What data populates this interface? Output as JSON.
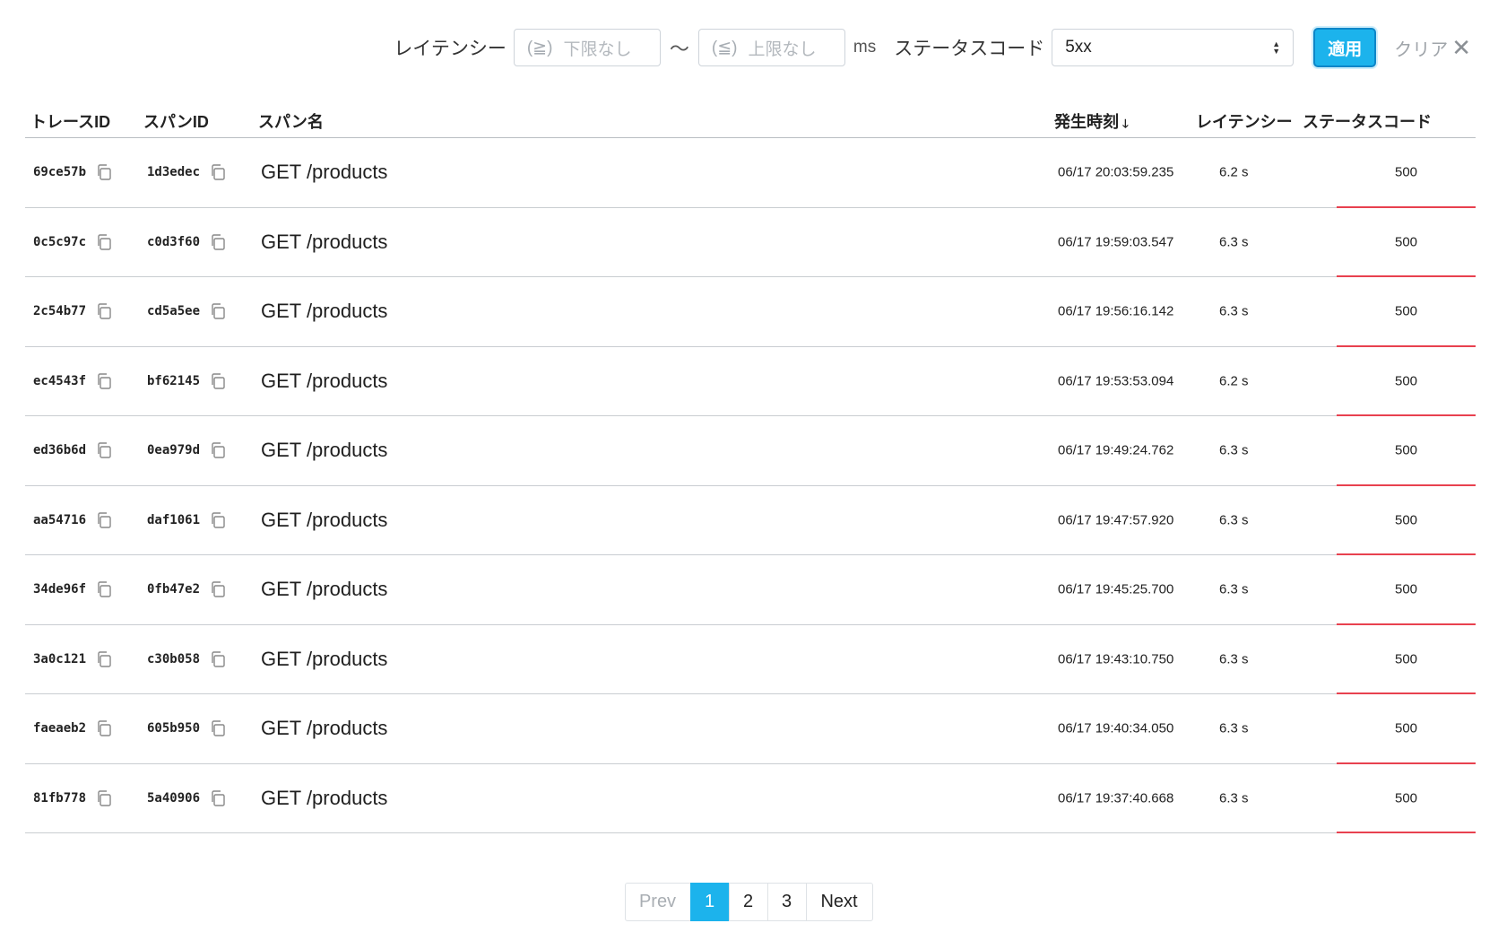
{
  "filter": {
    "latency_label": "レイテンシー",
    "min_operator": "(≧)",
    "min_placeholder": "下限なし",
    "range_separator": "～",
    "max_operator": "(≦)",
    "max_placeholder": "上限なし",
    "unit": "ms",
    "status_label": "ステータスコード",
    "status_selected": "5xx",
    "apply_label": "適用",
    "clear_label": "クリア"
  },
  "table": {
    "headers": {
      "trace_id": "トレースID",
      "span_id": "スパンID",
      "span_name": "スパン名",
      "timestamp": "発生時刻",
      "latency": "レイテンシー",
      "status": "ステータスコード"
    },
    "sort_column": "timestamp",
    "sort_direction": "desc",
    "rows": [
      {
        "trace_id": "69ce57b",
        "span_id": "1d3edec",
        "span_name": "GET /products",
        "timestamp": "06/17 20:03:59.235",
        "latency": "6.2 s",
        "status": "500"
      },
      {
        "trace_id": "0c5c97c",
        "span_id": "c0d3f60",
        "span_name": "GET /products",
        "timestamp": "06/17 19:59:03.547",
        "latency": "6.3 s",
        "status": "500"
      },
      {
        "trace_id": "2c54b77",
        "span_id": "cd5a5ee",
        "span_name": "GET /products",
        "timestamp": "06/17 19:56:16.142",
        "latency": "6.3 s",
        "status": "500"
      },
      {
        "trace_id": "ec4543f",
        "span_id": "bf62145",
        "span_name": "GET /products",
        "timestamp": "06/17 19:53:53.094",
        "latency": "6.2 s",
        "status": "500"
      },
      {
        "trace_id": "ed36b6d",
        "span_id": "0ea979d",
        "span_name": "GET /products",
        "timestamp": "06/17 19:49:24.762",
        "latency": "6.3 s",
        "status": "500"
      },
      {
        "trace_id": "aa54716",
        "span_id": "daf1061",
        "span_name": "GET /products",
        "timestamp": "06/17 19:47:57.920",
        "latency": "6.3 s",
        "status": "500"
      },
      {
        "trace_id": "34de96f",
        "span_id": "0fb47e2",
        "span_name": "GET /products",
        "timestamp": "06/17 19:45:25.700",
        "latency": "6.3 s",
        "status": "500"
      },
      {
        "trace_id": "3a0c121",
        "span_id": "c30b058",
        "span_name": "GET /products",
        "timestamp": "06/17 19:43:10.750",
        "latency": "6.3 s",
        "status": "500"
      },
      {
        "trace_id": "faeaeb2",
        "span_id": "605b950",
        "span_name": "GET /products",
        "timestamp": "06/17 19:40:34.050",
        "latency": "6.3 s",
        "status": "500"
      },
      {
        "trace_id": "81fb778",
        "span_id": "5a40906",
        "span_name": "GET /products",
        "timestamp": "06/17 19:37:40.668",
        "latency": "6.3 s",
        "status": "500"
      }
    ]
  },
  "pagination": {
    "prev_label": "Prev",
    "pages": [
      "1",
      "2",
      "3"
    ],
    "current_page": "1",
    "next_label": "Next"
  },
  "colors": {
    "accent": "#1cb3ec",
    "error_underline": "#e8414f"
  },
  "icons": {
    "copy": "copy-icon",
    "clear": "close-icon",
    "sort": "arrow-down-icon",
    "select": "select-arrows-icon"
  }
}
